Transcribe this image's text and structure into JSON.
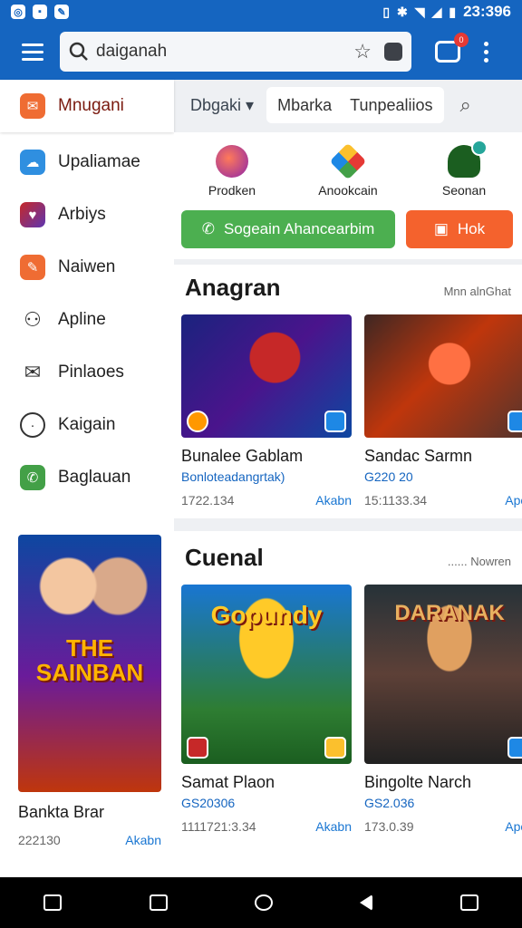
{
  "status": {
    "time": "23:396"
  },
  "search": {
    "value": "daiganah"
  },
  "notifications": {
    "badge": "0"
  },
  "drawer": {
    "items": [
      {
        "label": "Mnugani",
        "icon": "chat-bubble-icon"
      },
      {
        "label": "Upaliamae",
        "icon": "cloud-icon"
      },
      {
        "label": "Arbiys",
        "icon": "heart-icon"
      },
      {
        "label": "Naiwen",
        "icon": "edit-icon"
      },
      {
        "label": "Apline",
        "icon": "people-icon"
      },
      {
        "label": "Pinlaoes",
        "icon": "mail-icon"
      },
      {
        "label": "Kaigain",
        "icon": "circle-icon"
      },
      {
        "label": "Baglauan",
        "icon": "whatsapp-icon"
      }
    ]
  },
  "topnav": {
    "dropdown": "Dbgaki",
    "tabs": [
      "Mbarka",
      "Tunpealiios"
    ]
  },
  "quick": {
    "actions": [
      {
        "label": "Prodken"
      },
      {
        "label": "Anookcain"
      },
      {
        "label": "Seonan"
      }
    ],
    "primary_button": "Sogeain Ahancearbim",
    "secondary_button": "Hok"
  },
  "section1": {
    "title": "Anagran",
    "more": "Mnn alnGhat",
    "cards": [
      {
        "name": "Bunalee Gablam",
        "sub": "Bonloteadangrtak)",
        "meta": "1722.134",
        "action": "Akabn"
      },
      {
        "name": "Sandac Sarmn",
        "sub": "G220 20",
        "meta": "15:1133.34",
        "action": "Apon"
      }
    ]
  },
  "section2": {
    "title": "Cuenal",
    "more": "...... Nowren",
    "cards": [
      {
        "name": "Samat Plaon",
        "sub": "GS20306",
        "art_title": "Gopundy",
        "meta": "1111721:3.34",
        "action": "Akabn"
      },
      {
        "name": "Bingolte Narch",
        "sub": "GS2.036",
        "art_title": "DARANAK",
        "meta": "173.0.39",
        "action": "Apon"
      }
    ]
  },
  "poster": {
    "art_title": "THE SAINBAN",
    "name": "Bankta Brar",
    "meta": "222130",
    "action": "Akabn"
  },
  "colors": {
    "primary": "#1565c0",
    "green": "#4caf50",
    "orange": "#f4622d"
  }
}
